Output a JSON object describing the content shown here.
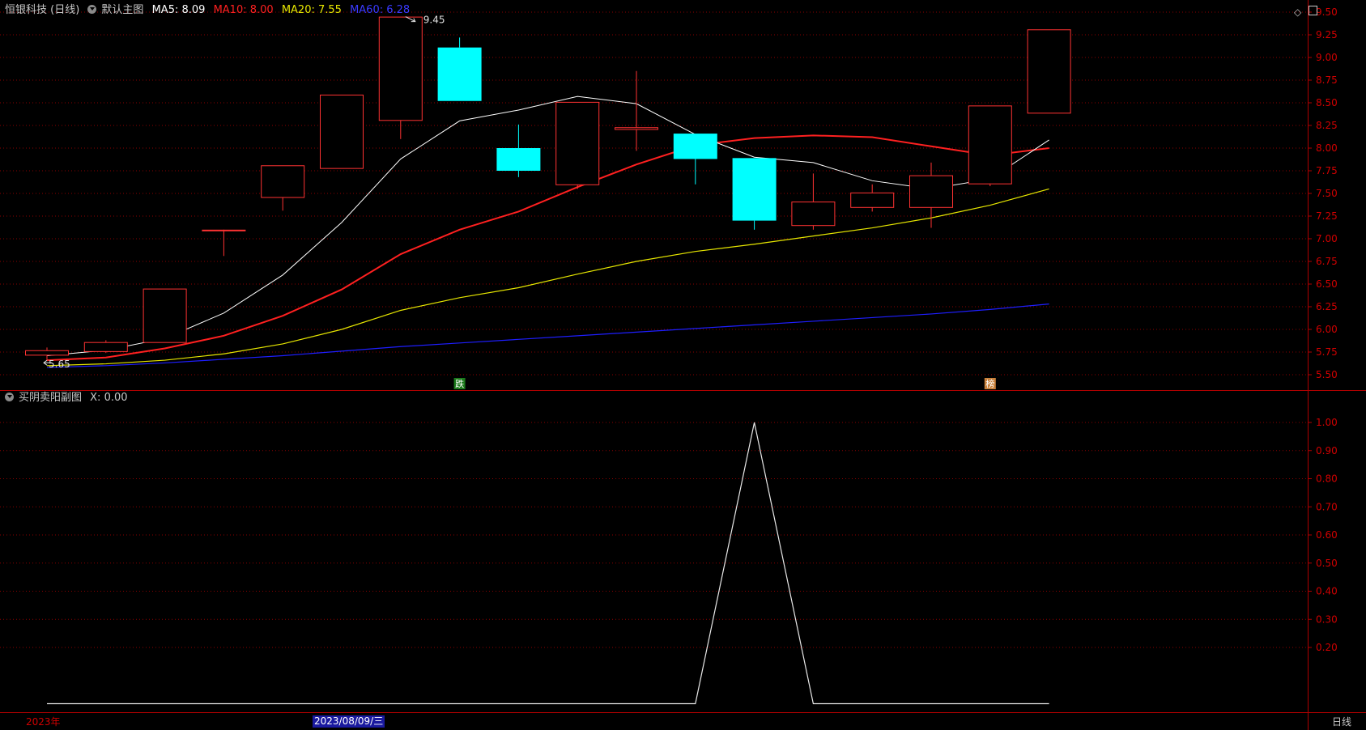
{
  "header_main": {
    "title": "恒银科技 (日线)",
    "indicator_name": "默认主图",
    "ma5": "MA5: 8.09",
    "ma10": "MA10: 8.00",
    "ma20": "MA20: 7.55",
    "ma60": "MA60: 6.28"
  },
  "header_sub": {
    "indicator_name": "买阴卖阳副图",
    "value": "X: 0.00"
  },
  "colors": {
    "up": "#ff3232",
    "down": "#00ffff",
    "ma5": "#ffffff",
    "ma10": "#ff2020",
    "ma20": "#e6e600",
    "ma60": "#1e1eff",
    "grid": "#8b0000",
    "axis_text": "#d00000"
  },
  "bottom_bar": {
    "year": "2023年",
    "date": "2023/08/09/三",
    "period": "日线"
  },
  "chart_data": [
    {
      "type": "candlestick",
      "title": "",
      "ylim": [
        5.4,
        9.6
      ],
      "y_ticks": [
        "9.50",
        "9.25",
        "9.00",
        "8.75",
        "8.50",
        "8.25",
        "8.00",
        "7.75",
        "7.50",
        "7.25",
        "7.00",
        "6.75",
        "6.50",
        "6.25",
        "6.00",
        "5.75",
        "5.50"
      ],
      "candles": [
        {
          "o": 5.72,
          "c": 5.77,
          "h": 5.8,
          "l": 5.66
        },
        {
          "o": 5.76,
          "c": 5.86,
          "h": 5.88,
          "l": 5.74
        },
        {
          "o": 5.86,
          "c": 6.45,
          "h": 6.45,
          "l": 5.86
        },
        {
          "o": 7.1,
          "c": 7.1,
          "h": 7.1,
          "l": 6.81
        },
        {
          "o": 7.46,
          "c": 7.81,
          "h": 7.81,
          "l": 7.31
        },
        {
          "o": 7.78,
          "c": 8.59,
          "h": 8.59,
          "l": 7.78
        },
        {
          "o": 8.31,
          "c": 9.45,
          "h": 9.45,
          "l": 8.1
        },
        {
          "o": 9.11,
          "c": 8.52,
          "h": 9.22,
          "l": 8.52
        },
        {
          "o": 8.0,
          "c": 7.75,
          "h": 8.26,
          "l": 7.68
        },
        {
          "o": 7.6,
          "c": 8.51,
          "h": 8.51,
          "l": 7.55
        },
        {
          "o": 8.21,
          "c": 8.23,
          "h": 8.85,
          "l": 7.97
        },
        {
          "o": 8.16,
          "c": 7.88,
          "h": 8.16,
          "l": 7.6
        },
        {
          "o": 7.89,
          "c": 7.2,
          "h": 7.89,
          "l": 7.1
        },
        {
          "o": 7.15,
          "c": 7.41,
          "h": 7.72,
          "l": 7.1
        },
        {
          "o": 7.35,
          "c": 7.51,
          "h": 7.6,
          "l": 7.3
        },
        {
          "o": 7.35,
          "c": 7.7,
          "h": 7.84,
          "l": 7.12
        },
        {
          "o": 7.61,
          "c": 8.47,
          "h": 8.47,
          "l": 7.58
        },
        {
          "o": 8.39,
          "c": 9.31,
          "h": 9.31,
          "l": 8.39
        }
      ],
      "ma5": [
        5.71,
        5.77,
        5.9,
        6.18,
        6.6,
        7.18,
        7.88,
        8.3,
        8.42,
        8.57,
        8.49,
        8.15,
        7.9,
        7.84,
        7.64,
        7.55,
        7.66,
        8.09
      ],
      "ma10": [
        5.66,
        5.69,
        5.79,
        5.93,
        6.15,
        6.44,
        6.83,
        7.1,
        7.3,
        7.57,
        7.82,
        8.03,
        8.11,
        8.14,
        8.12,
        8.02,
        7.92,
        8.0
      ],
      "ma20": [
        5.6,
        5.62,
        5.66,
        5.73,
        5.84,
        6.0,
        6.21,
        6.35,
        6.46,
        6.61,
        6.75,
        6.86,
        6.94,
        7.03,
        7.12,
        7.23,
        7.37,
        7.55
      ],
      "ma60": [
        5.58,
        5.6,
        5.63,
        5.67,
        5.71,
        5.76,
        5.81,
        5.85,
        5.89,
        5.93,
        5.97,
        6.01,
        6.05,
        6.09,
        6.13,
        6.17,
        6.22,
        6.28
      ],
      "annotations": [
        {
          "label": "9.45",
          "candle": 6,
          "price": 9.45
        },
        {
          "label": "5.65",
          "candle": 0,
          "price": 5.65
        },
        {
          "label": "跌",
          "candle": 7,
          "kind": "green"
        },
        {
          "label": "榜",
          "candle": 16,
          "kind": "orange"
        }
      ]
    },
    {
      "type": "line",
      "title": "",
      "ylim": [
        0.05,
        1.05
      ],
      "y_ticks": [
        "1.00",
        "0.90",
        "0.80",
        "0.70",
        "0.60",
        "0.50",
        "0.40",
        "0.30",
        "0.20"
      ],
      "x": [
        0.0,
        11.0,
        12.0,
        13.0,
        17.0
      ],
      "values": [
        0,
        0,
        1,
        0,
        0
      ]
    }
  ]
}
